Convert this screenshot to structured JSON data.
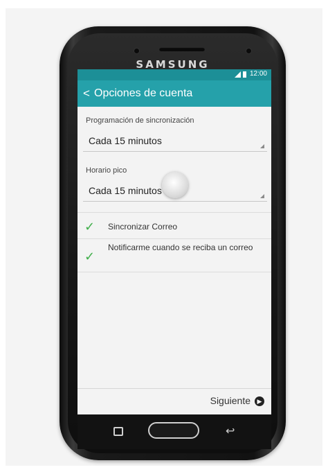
{
  "device": {
    "brand": "SAMSUNG"
  },
  "status_bar": {
    "time": "12:00"
  },
  "action_bar": {
    "back_glyph": "<",
    "title": "Opciones de cuenta"
  },
  "settings": {
    "sync_schedule_label": "Programación de sincronización",
    "sync_schedule_value": "Cada 15 minutos",
    "peak_schedule_label": "Horario pico",
    "peak_schedule_value": "Cada 15 minutos"
  },
  "checkboxes": [
    {
      "label": "Sincronizar Correo",
      "checked": true
    },
    {
      "label": "Notificarme cuando se reciba un correo",
      "checked": true
    }
  ],
  "footer": {
    "next_label": "Siguiente",
    "next_icon": "chevron-right-circle-icon"
  },
  "colors": {
    "status_bar": "#1c8f97",
    "action_bar": "#25a1aa",
    "check": "#3fae49"
  }
}
